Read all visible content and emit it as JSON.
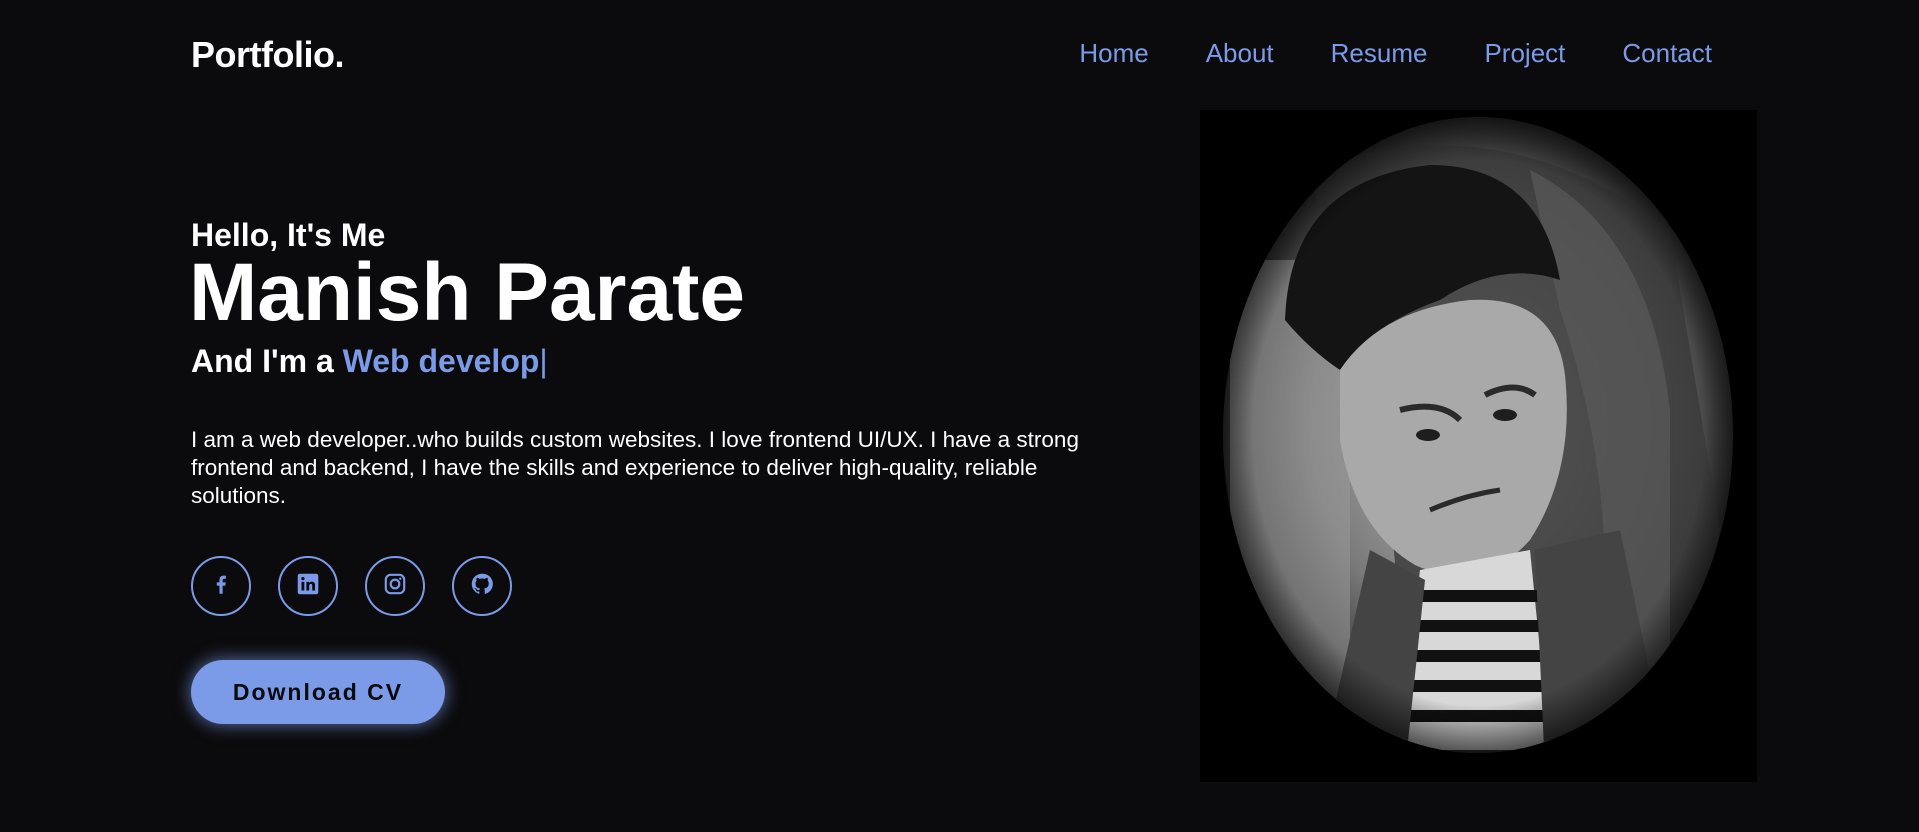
{
  "header": {
    "logo": "Portfolio.",
    "nav": [
      "Home",
      "About",
      "Resume",
      "Project",
      "Contact"
    ]
  },
  "hero": {
    "greeting": "Hello, It's Me",
    "name": "Manish Parate",
    "role_prefix": "And I'm a ",
    "role_typed": "Web develop",
    "cursor": "|",
    "bio": "I am a web developer..who builds custom websites. I love frontend UI/UX. I have a strong frontend and backend, I have the skills and experience to deliver high-quality, reliable solutions."
  },
  "socials": [
    {
      "icon": "facebook-icon"
    },
    {
      "icon": "linkedin-icon"
    },
    {
      "icon": "instagram-icon"
    },
    {
      "icon": "github-icon"
    }
  ],
  "cta": {
    "label": "Download CV"
  },
  "portrait": {
    "description_icon": "profile-photo"
  },
  "colors": {
    "background": "#0b0a0c",
    "accent": "#7b9ae8",
    "text": "#ffffff"
  }
}
